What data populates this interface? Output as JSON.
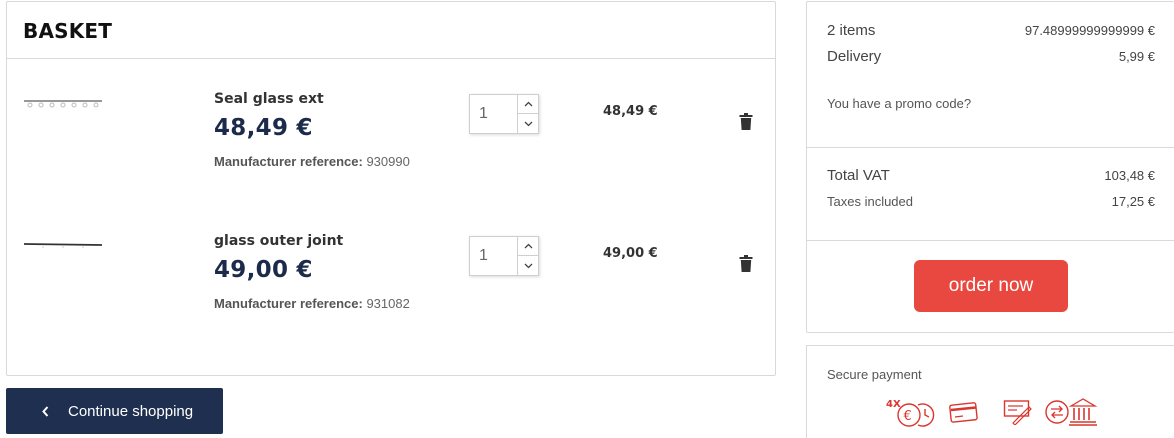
{
  "basket": {
    "title": "BASKET",
    "items": [
      {
        "name": "Seal glass ext",
        "price": "48,49 €",
        "ref_label": "Manufacturer reference:",
        "ref_value": "930990",
        "quantity": "1",
        "line_total": "48,49 €"
      },
      {
        "name": "glass outer joint",
        "price": "49,00 €",
        "ref_label": "Manufacturer reference:",
        "ref_value": "931082",
        "quantity": "1",
        "line_total": "49,00 €"
      }
    ],
    "continue_label": "Continue shopping"
  },
  "summary": {
    "items_label": "2 items",
    "items_value": "97.48999999999999 €",
    "delivery_label": "Delivery",
    "delivery_value": "5,99 €",
    "promo_label": "You have a promo code?",
    "total_label": "Total VAT",
    "total_value": "103,48 €",
    "taxes_label": "Taxes included",
    "taxes_value": "17,25 €",
    "order_label": "order now"
  },
  "secure_payment": {
    "title": "Secure payment",
    "icons": [
      "installments-4x-icon",
      "credit-card-icon",
      "cheque-icon",
      "bank-transfer-icon"
    ],
    "installments_badge": "4X"
  },
  "colors": {
    "navy": "#1f2f4f",
    "price_navy": "#1d2b4a",
    "order_red": "#e8483f",
    "icon_red": "#d9362f",
    "border": "#d9d9d9"
  }
}
